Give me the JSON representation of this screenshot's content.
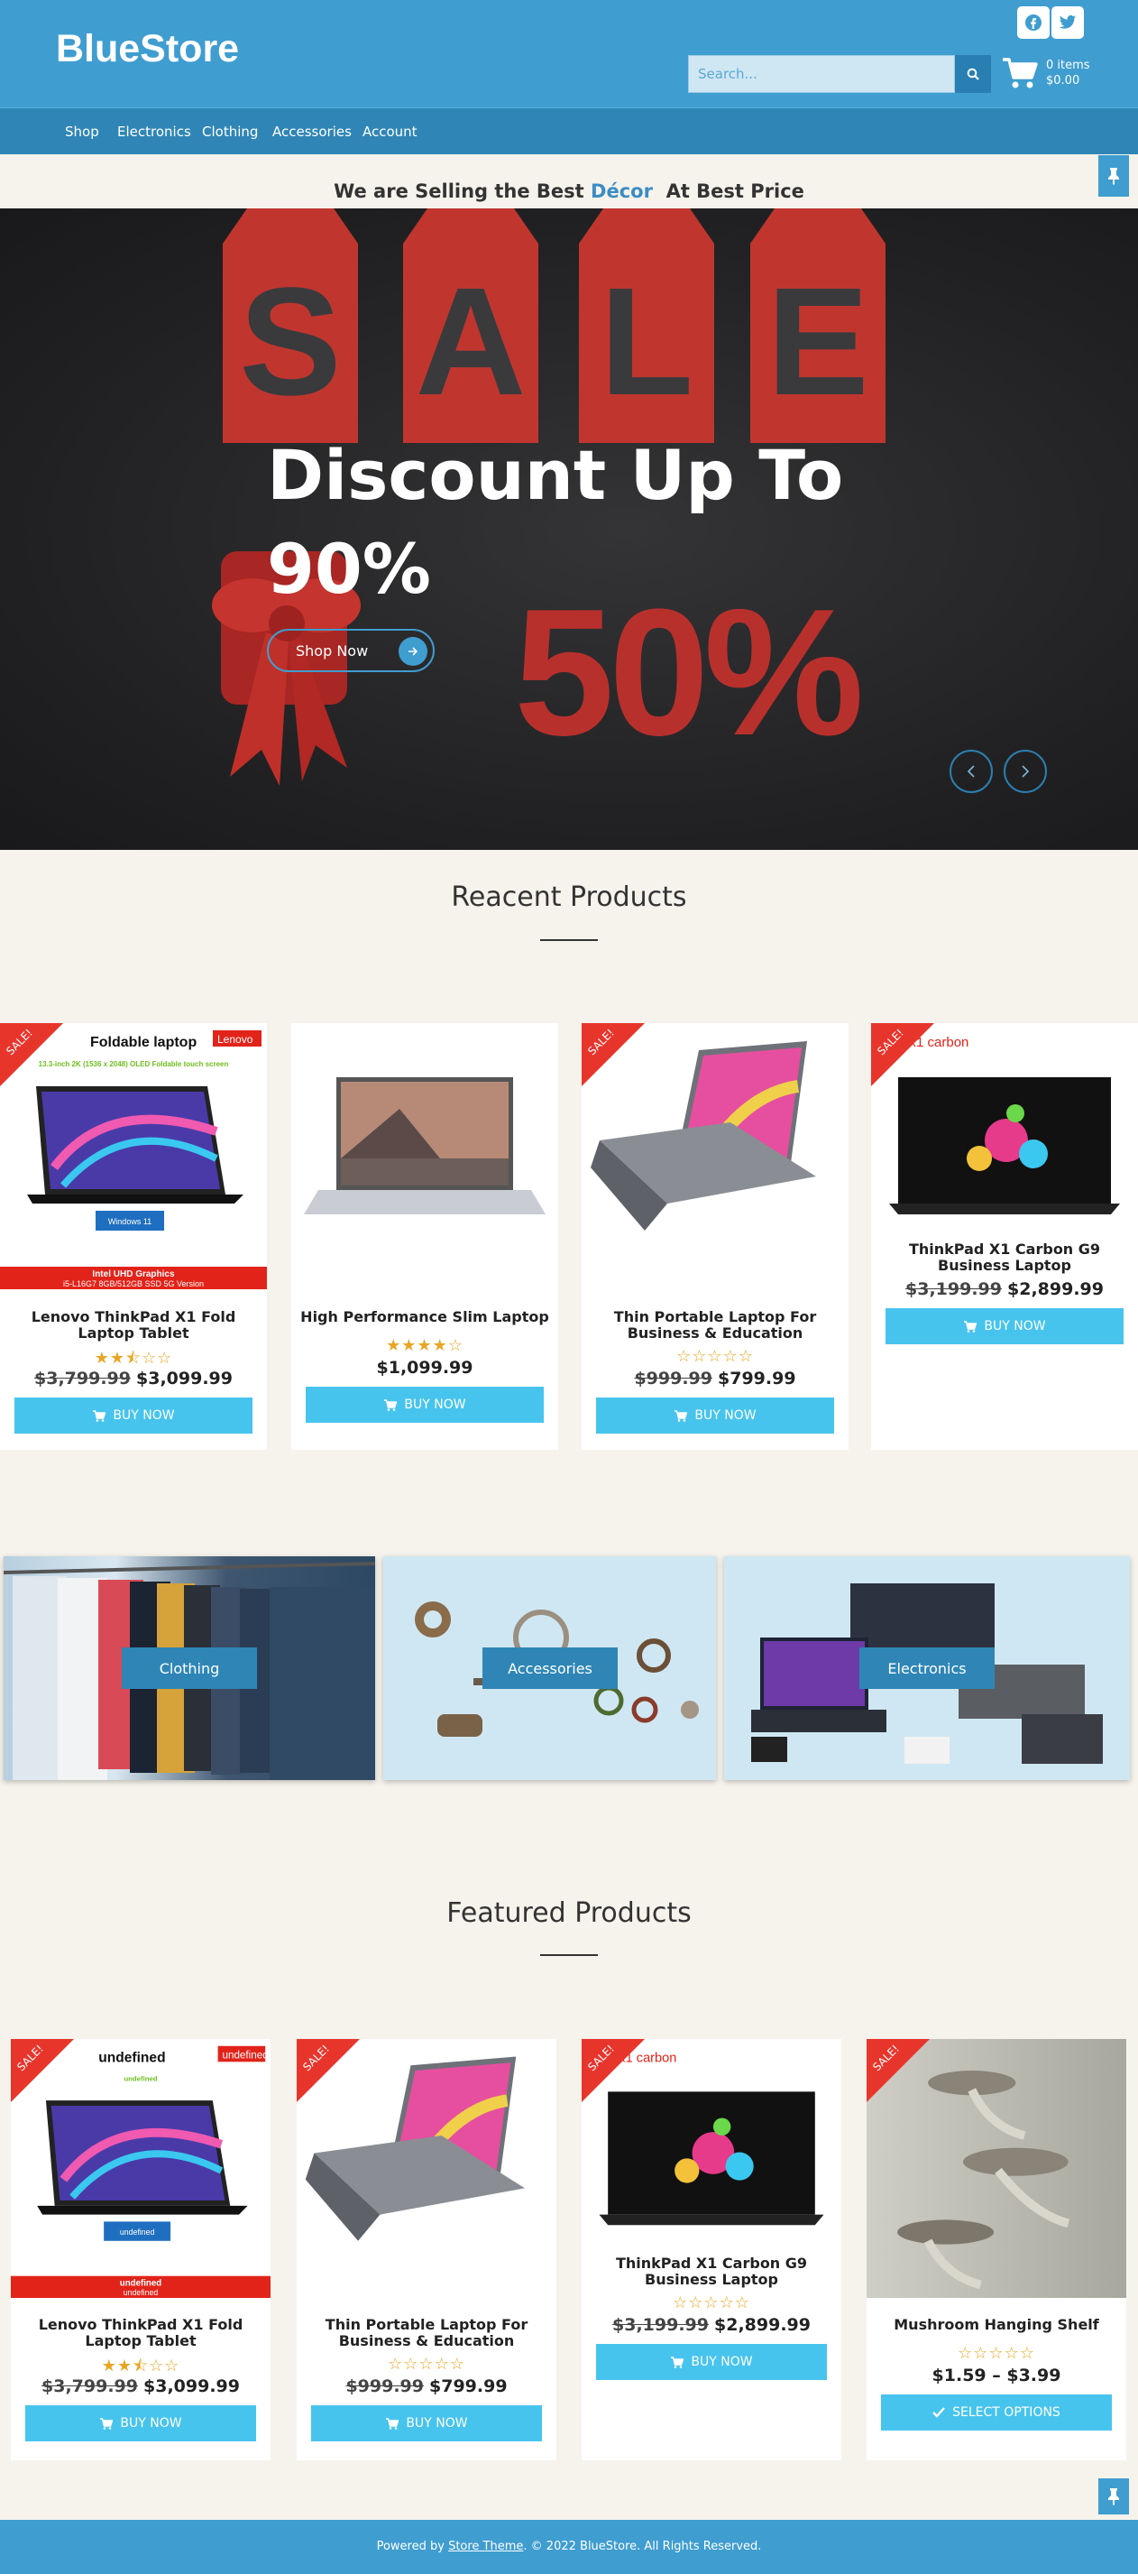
{
  "header": {
    "logo": "BlueStore",
    "search_placeholder": "Search...",
    "cart_items": "0 items",
    "cart_total": "$0.00",
    "social": [
      "facebook-icon",
      "twitter-icon"
    ]
  },
  "nav": [
    "Shop",
    "Electronics",
    "Clothing",
    "Accessories",
    "Account"
  ],
  "tagline": {
    "pre": "We are Selling the Best",
    "highlight": "Décor",
    "post": "At Best Price"
  },
  "hero": {
    "sale_letters": [
      "S",
      "A",
      "L",
      "E"
    ],
    "big_percent": "50%",
    "headline_1": "Discount Up To",
    "headline_2": "90%",
    "cta": "Shop Now"
  },
  "recent": {
    "title": "Reacent Products",
    "products": [
      {
        "name": "Lenovo ThinkPad X1 Fold Laptop Tablet",
        "sale": true,
        "rating": 2.5,
        "old_price": "$3,799.99",
        "price": "$3,099.99",
        "button": "BUY NOW",
        "banner_title": "Foldable laptop",
        "banner_brand": "Lenovo",
        "banner_sub": "13.3-inch 2K (1536 x 2048) OLED Foldable touch screen",
        "banner_badge": "Windows 11",
        "banner_foot1": "Intel UHD Graphics",
        "banner_foot2": "i5-L16G7  8GB/512GB SSD  5G Version"
      },
      {
        "name": "High Performance Slim Laptop",
        "sale": false,
        "rating": 4,
        "old_price": "",
        "price": "$1,099.99",
        "button": "BUY NOW"
      },
      {
        "name": "Thin Portable Laptop For Business & Education",
        "sale": true,
        "rating": 0,
        "old_price": "$999.99",
        "price": "$799.99",
        "button": "BUY NOW"
      },
      {
        "name": "ThinkPad X1 Carbon G9 Business Laptop",
        "sale": true,
        "rating": 0,
        "old_price": "$3,199.99",
        "price": "$2,899.99",
        "button": "BUY NOW",
        "banner_title": "X1 carbon"
      }
    ]
  },
  "categories": [
    "Clothing",
    "Accessories",
    "Electronics"
  ],
  "featured": {
    "title": "Featured Products",
    "products": [
      {
        "name": "Lenovo ThinkPad X1 Fold Laptop Tablet",
        "sale": true,
        "rating": 2.5,
        "old_price": "$3,799.99",
        "price": "$3,099.99",
        "button": "BUY NOW"
      },
      {
        "name": "Thin Portable Laptop For Business & Education",
        "sale": true,
        "rating": 0,
        "old_price": "$999.99",
        "price": "$799.99",
        "button": "BUY NOW"
      },
      {
        "name": "ThinkPad X1 Carbon G9 Business Laptop",
        "sale": true,
        "rating": 0,
        "old_price": "$3,199.99",
        "price": "$2,899.99",
        "button": "BUY NOW"
      },
      {
        "name": "Mushroom Hanging Shelf",
        "sale": true,
        "rating": 0,
        "old_price": "",
        "price": "$1.59 – $3.99",
        "button": "SELECT OPTIONS"
      }
    ]
  },
  "sale_label": "SALE!",
  "footer": {
    "pre": "Powered by",
    "link": "Store Theme",
    "post": ". © 2022 BlueStore. All Rights Reserved."
  },
  "colors": {
    "primary": "#3f9dd0",
    "nav": "#2f86b6",
    "button": "#47c4ee",
    "sale": "#e8352c",
    "star": "#e8a623"
  }
}
